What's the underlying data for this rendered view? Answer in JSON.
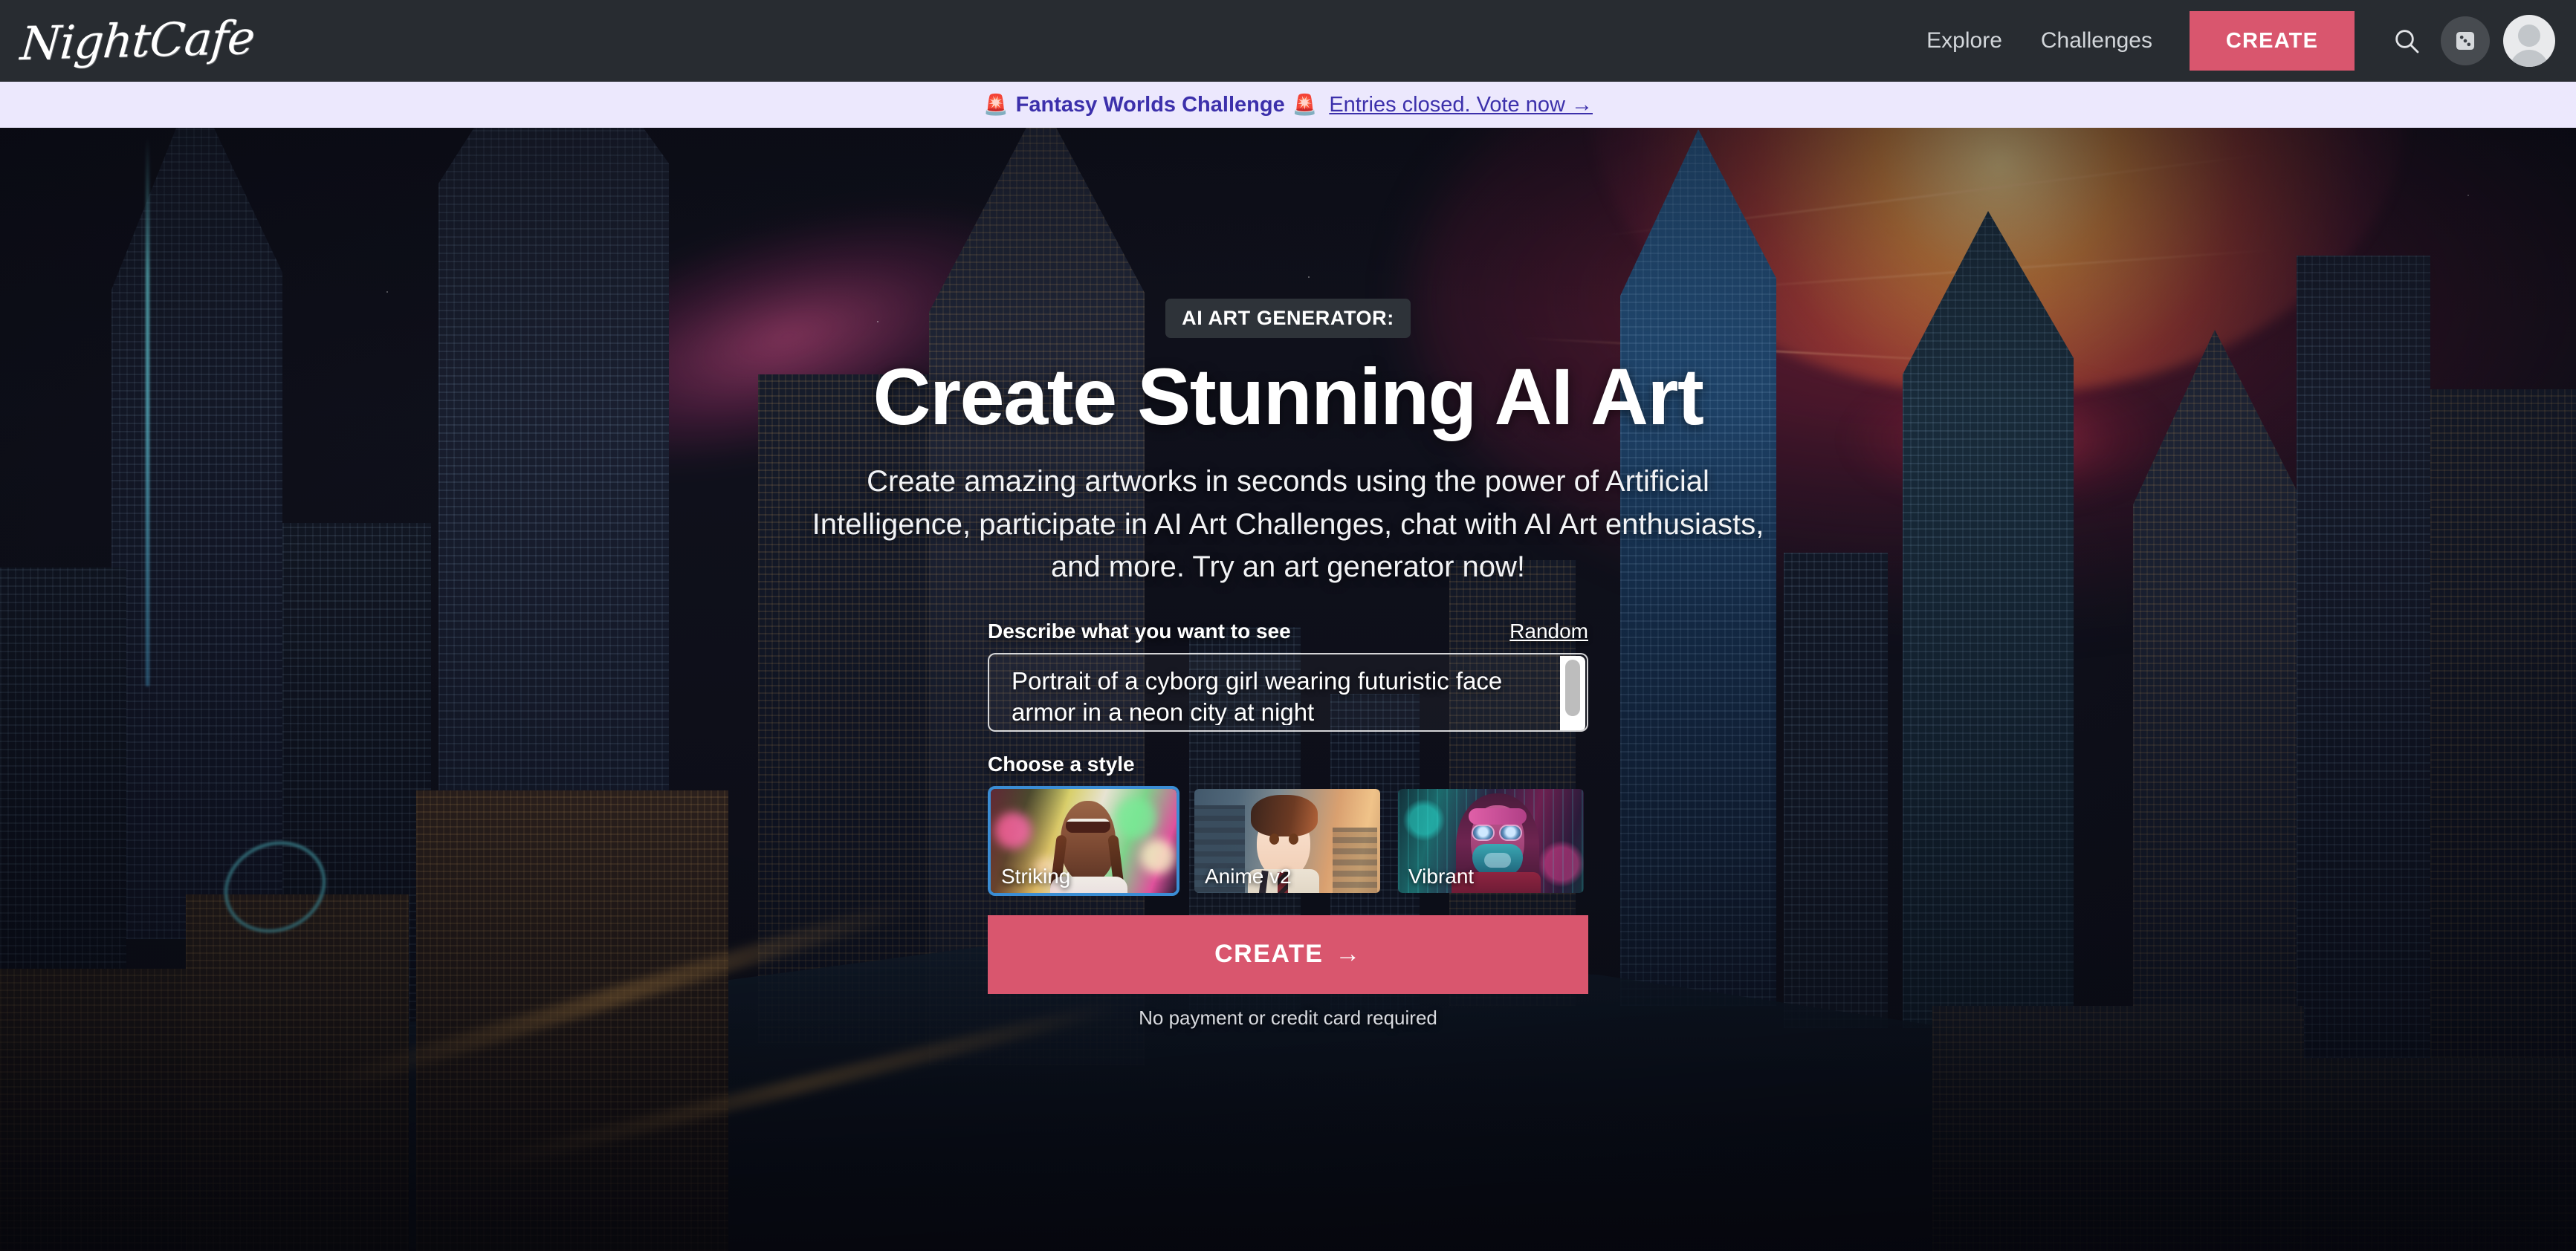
{
  "header": {
    "logo": "NightCafe",
    "nav": [
      {
        "label": "Explore"
      },
      {
        "label": "Challenges"
      }
    ],
    "create_label": "CREATE",
    "icons": {
      "search": "search-icon",
      "dice": "dice-icon",
      "avatar": "avatar-icon"
    },
    "bg_color": "#282c31",
    "accent_color": "#d9566e"
  },
  "banner": {
    "emoji_left": "🚨",
    "title": "Fantasy Worlds Challenge",
    "emoji_right": "🚨",
    "link": "Entries closed. Vote now →",
    "bg_color": "#ece8fd",
    "text_color": "#3c30ab"
  },
  "hero": {
    "eyebrow": "AI ART GENERATOR:",
    "headline": "Create Stunning AI Art",
    "subhead": "Create amazing artworks in seconds using the power of Artificial Intelligence, participate in AI Art Challenges, chat with AI Art enthusiasts, and more. Try an art generator now!"
  },
  "form": {
    "prompt_label": "Describe what you want to see",
    "random_label": "Random",
    "prompt_value": "Portrait of a cyborg girl wearing futuristic face armor in a neon city at night",
    "prompt_placeholder": "Describe what you want to see",
    "style_label": "Choose a style",
    "styles": [
      {
        "name": "Striking",
        "selected": true
      },
      {
        "name": "Anime v2",
        "selected": false
      },
      {
        "name": "Vibrant",
        "selected": false
      }
    ],
    "selected_style": "Striking",
    "create_label": "CREATE",
    "create_arrow": "→",
    "footnote": "No payment or credit card required",
    "selected_border_color": "#3b8dd4",
    "create_color": "#d9566e"
  }
}
